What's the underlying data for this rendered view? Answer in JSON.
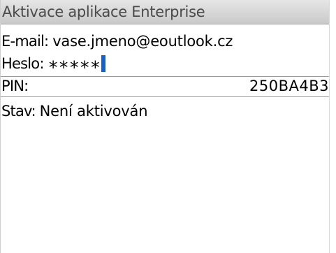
{
  "window": {
    "title": "Aktivace aplikace Enterprise"
  },
  "form": {
    "email_label": "E-mail:",
    "email_value": "vase.jmeno@eoutlook.cz",
    "password_label": "Heslo:",
    "password_value": "∗∗∗∗∗",
    "pin_label": "PIN:",
    "pin_value": "250BA4B3",
    "status_label": "Stav:",
    "status_value": "Není aktivován"
  },
  "colors": {
    "cursor": "#1a5fc8",
    "title_text": "#4a4a4a",
    "title_bg_top": "#e6e6e6",
    "title_bg_bottom": "#c9c9c9"
  }
}
